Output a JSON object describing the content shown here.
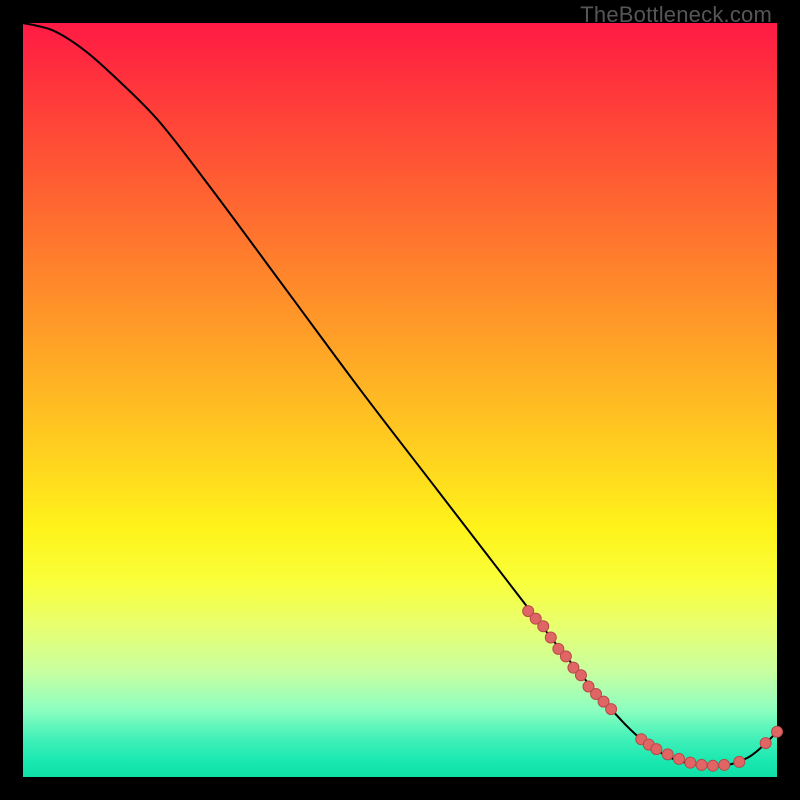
{
  "watermark": "TheBottleneck.com",
  "colors": {
    "background": "#000000",
    "gradient_top": "#ff1a45",
    "gradient_bottom": "#0ee0a8",
    "curve_stroke": "#000000",
    "dot_fill": "#e06666",
    "dot_stroke": "#b84a4a"
  },
  "chart_data": {
    "type": "line",
    "title": "",
    "xlabel": "",
    "ylabel": "",
    "xlim": [
      0,
      100
    ],
    "ylim": [
      0,
      100
    ],
    "series": [
      {
        "name": "curve",
        "x": [
          0,
          4,
          8,
          12,
          18,
          25,
          35,
          45,
          55,
          65,
          72,
          78,
          82,
          86,
          90,
          93,
          96,
          98,
          100
        ],
        "y": [
          100,
          99,
          96.5,
          93,
          87,
          78,
          64.5,
          51,
          38,
          25,
          16,
          9,
          5,
          2.5,
          1.5,
          1.5,
          2.5,
          4,
          6
        ]
      }
    ],
    "dot_clusters": [
      {
        "name": "cluster-steep",
        "points": [
          [
            67,
            22
          ],
          [
            68,
            21
          ],
          [
            69,
            20
          ],
          [
            70,
            18.5
          ],
          [
            71,
            17
          ],
          [
            72,
            16
          ],
          [
            73,
            14.5
          ],
          [
            74,
            13.5
          ],
          [
            75,
            12
          ],
          [
            76,
            11
          ],
          [
            77,
            10
          ],
          [
            78,
            9
          ]
        ]
      },
      {
        "name": "cluster-valley",
        "points": [
          [
            82,
            5
          ],
          [
            83,
            4.3
          ],
          [
            84,
            3.7
          ],
          [
            85.5,
            3
          ],
          [
            87,
            2.4
          ],
          [
            88.5,
            1.9
          ],
          [
            90,
            1.6
          ],
          [
            91.5,
            1.5
          ],
          [
            93,
            1.6
          ],
          [
            95,
            2
          ]
        ]
      },
      {
        "name": "cluster-rise",
        "points": [
          [
            98.5,
            4.5
          ],
          [
            100,
            6
          ]
        ]
      }
    ]
  }
}
